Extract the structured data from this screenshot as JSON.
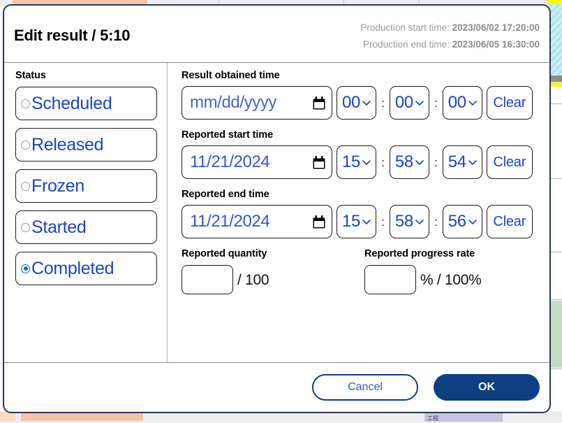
{
  "dialog": {
    "title": "Edit result / 5:10",
    "production": {
      "start_label": "Production start time:",
      "start_value": "2023/06/02 17:20:00",
      "end_label": "Production end time:",
      "end_value": "2023/06/05 16:30:00"
    }
  },
  "status": {
    "label": "Status",
    "options": [
      {
        "label": "Scheduled",
        "selected": false
      },
      {
        "label": "Released",
        "selected": false
      },
      {
        "label": "Frozen",
        "selected": false
      },
      {
        "label": "Started",
        "selected": false
      },
      {
        "label": "Completed",
        "selected": true
      }
    ]
  },
  "fields": {
    "result_obtained": {
      "label": "Result obtained time",
      "date_value": "",
      "date_placeholder": "mm/dd/yyyy",
      "hour": "00",
      "minute": "00",
      "second": "00",
      "clear_label": "Clear"
    },
    "reported_start": {
      "label": "Reported start time",
      "date_value": "11/21/2024",
      "date_placeholder": "mm/dd/yyyy",
      "hour": "15",
      "minute": "58",
      "second": "54",
      "clear_label": "Clear"
    },
    "reported_end": {
      "label": "Reported end time",
      "date_value": "11/21/2024",
      "date_placeholder": "mm/dd/yyyy",
      "hour": "15",
      "minute": "58",
      "second": "56",
      "clear_label": "Clear"
    },
    "reported_quantity": {
      "label": "Reported quantity",
      "value": "",
      "unit": "/ 100"
    },
    "reported_progress_rate": {
      "label": "Reported progress rate",
      "value": "",
      "unit": "% / 100%"
    }
  },
  "separators": {
    "time_colon": ":"
  },
  "footer": {
    "cancel_label": "Cancel",
    "ok_label": "OK"
  },
  "background": {
    "lavender_label": "工程"
  },
  "colors": {
    "dialog_border": "#2a3756",
    "accent_blue": "#1c44c4",
    "primary_button": "#0d3f81",
    "muted_text": "#9a9a9a",
    "field_border": "#1b1b1b",
    "radio_selected": "#1467e0"
  }
}
